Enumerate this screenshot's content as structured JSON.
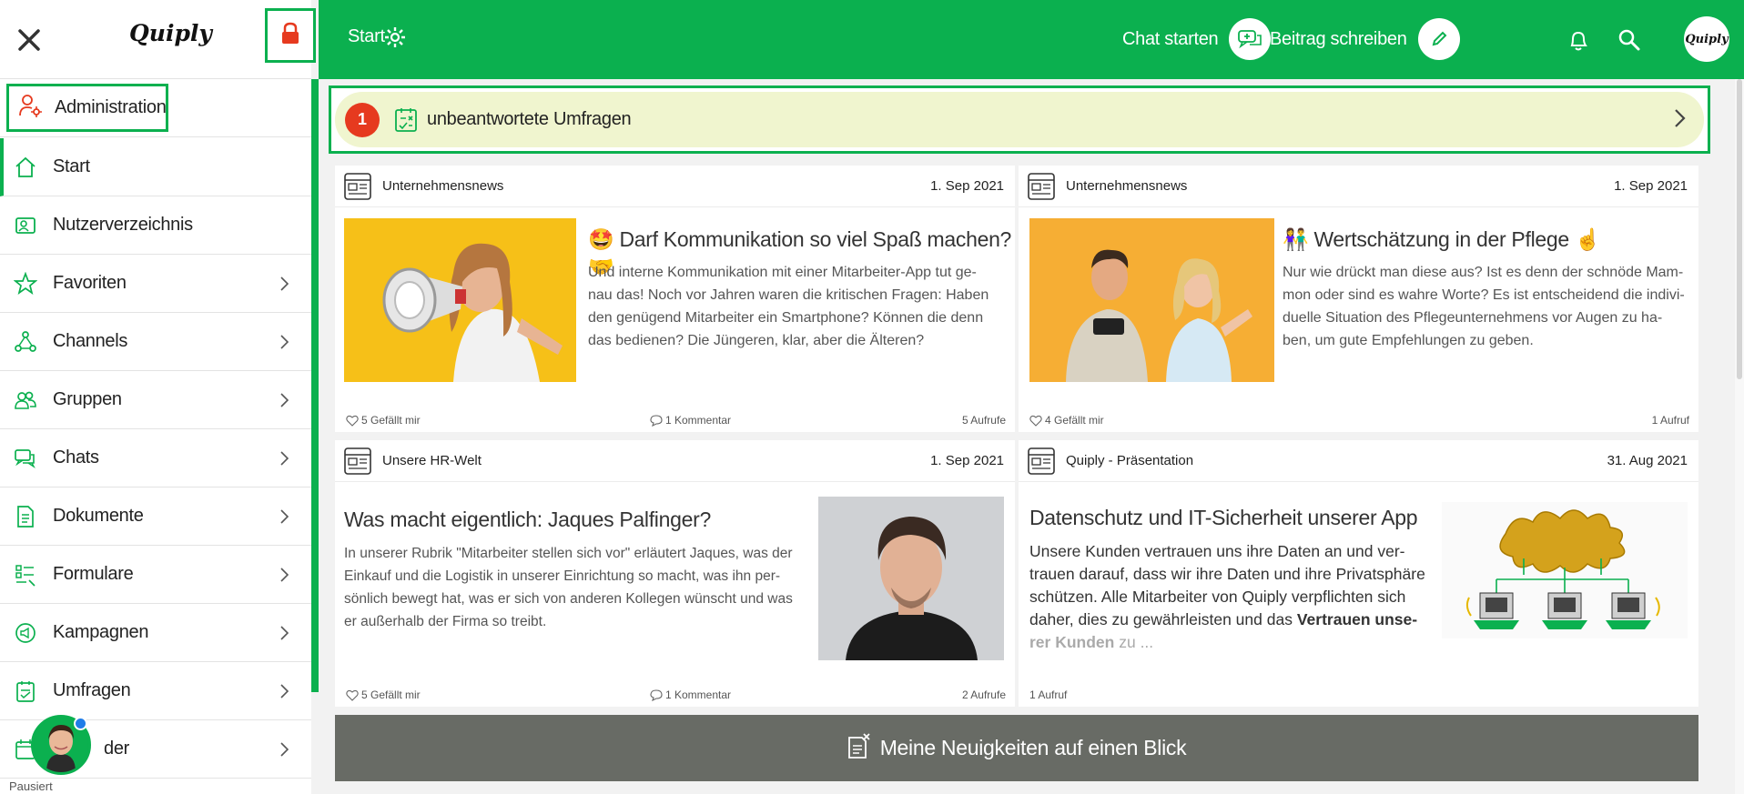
{
  "app": {
    "logo": "Quiply"
  },
  "colors": {
    "brand": "#0bb04f",
    "badge": "#e63a1f",
    "banner": "#f0f5cf",
    "footer_banner": "#686b65"
  },
  "sidebar": {
    "admin_label": "Administration",
    "items": [
      {
        "label": "Start",
        "icon": "home-icon",
        "chevron": false
      },
      {
        "label": "Nutzerverzeichnis",
        "icon": "user-directory-icon",
        "chevron": false
      },
      {
        "label": "Favoriten",
        "icon": "star-icon",
        "chevron": true
      },
      {
        "label": "Channels",
        "icon": "channels-icon",
        "chevron": true
      },
      {
        "label": "Gruppen",
        "icon": "groups-icon",
        "chevron": true
      },
      {
        "label": "Chats",
        "icon": "chats-icon",
        "chevron": true
      },
      {
        "label": "Dokumente",
        "icon": "document-icon",
        "chevron": true
      },
      {
        "label": "Formulare",
        "icon": "form-icon",
        "chevron": true
      },
      {
        "label": "Kampagnen",
        "icon": "campaign-icon",
        "chevron": true
      },
      {
        "label": "Umfragen",
        "icon": "survey-icon",
        "chevron": true
      },
      {
        "label": "der",
        "icon": "calendar-icon",
        "chevron": true
      }
    ],
    "chat_status": "Pausiert"
  },
  "topbar": {
    "title": "Start",
    "chat_start_label": "Chat starten",
    "write_post_label": "Beitrag schreiben"
  },
  "survey_banner": {
    "count": "1",
    "label": "unbeantwortete Umfragen"
  },
  "cards": [
    {
      "category": "Unternehmensnews",
      "date": "1. Sep 2021",
      "emoji_left": "🤩",
      "title": "Darf Kommunikation so viel Spaß machen?",
      "emoji_right": "🤝",
      "text_lines": [
        "Und interne Kommunikation mit einer Mitarbeiter-App tut ge-",
        "nau das! Noch vor Jahren waren die kritischen Fragen: Haben",
        "den genügend Mitarbeiter ein Smartphone? Können die denn",
        "das bedienen? Die Jüngeren, klar, aber die Älteren?"
      ],
      "likes": "5 Gefällt mir",
      "comments": "1 Kommentar",
      "views": "5 Aufrufe"
    },
    {
      "category": "Unternehmensnews",
      "date": "1. Sep 2021",
      "emoji_left": "👫",
      "title": "Wertschätzung in der Pflege",
      "emoji_right": "☝️",
      "text_lines": [
        "Nur wie drückt man diese aus? Ist es denn der schnöde Mam-",
        "mon oder sind es wahre Worte? Es ist entscheidend die indivi-",
        "duelle Situation des Pflegeunternehmens vor Augen zu ha-",
        "ben, um gute Empfehlungen zu geben."
      ],
      "likes": "4 Gefällt mir",
      "views": "1 Aufruf"
    },
    {
      "category": "Unsere HR-Welt",
      "date": "1. Sep 2021",
      "title": "Was macht eigentlich: Jaques Palfinger?",
      "text_lines": [
        "In unserer Rubrik \"Mitarbeiter stellen sich vor\" erläutert Jaques, was der",
        "Einkauf und die Logistik in unserer Einrichtung so macht, was ihn per-",
        "sönlich bewegt hat, was er sich von anderen Kollegen wünscht und was",
        "er außerhalb der Firma so treibt."
      ],
      "likes": "5 Gefällt mir",
      "comments": "1 Kommentar",
      "views": "2 Aufrufe"
    },
    {
      "category": "Quiply - Präsentation",
      "date": "31. Aug 2021",
      "title": "Datenschutz und IT-Sicherheit unserer App",
      "text_lines": [
        "Unsere Kunden vertrauen uns ihre Daten an und ver-",
        "trauen darauf, dass wir ihre Daten und ihre Privatsphäre",
        "schützen. Alle Mitarbeiter von Quiply verpflichten sich",
        "daher, dies zu gewährleisten und das"
      ],
      "text_bold": "Vertrauen unse-",
      "text_last_bold": "rer Kunden",
      "text_last_rest": " zu  ...",
      "views": "1 Aufruf"
    }
  ],
  "news_banner": {
    "label": "Meine Neuigkeiten auf einen Blick"
  }
}
